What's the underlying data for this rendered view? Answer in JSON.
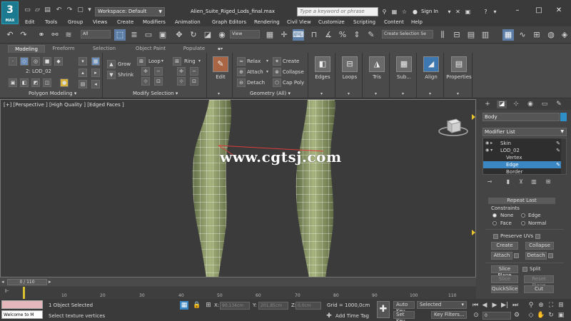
{
  "app": {
    "logo_text": "3",
    "logo_sub": "MAX",
    "title": "Alien_Suite_Riged_Lods_final.max",
    "workspace": "Workspace: Default",
    "search_placeholder": "Type a keyword or phrase",
    "signin": "Sign In"
  },
  "menu": [
    "Edit",
    "Tools",
    "Group",
    "Views",
    "Create",
    "Modifiers",
    "Animation",
    "Graph Editors",
    "Rendering",
    "Civil View",
    "Customize",
    "Scripting",
    "Content",
    "Help"
  ],
  "toolbar": {
    "selection_filter": "All",
    "ref_coord": "View",
    "named_selection": "Create Selection Se"
  },
  "ribbon": {
    "tabs": [
      "Modeling",
      "Freeform",
      "Selection",
      "Object Paint",
      "Populate"
    ],
    "lod_label": "2: LOD_02",
    "polygon_modeling": "Polygon Modeling",
    "modify_selection": "Modify Selection",
    "grow": "Grow",
    "shrink": "Shrink",
    "loop": "Loop",
    "ring": "Ring",
    "edit": "Edit",
    "relax": "Relax",
    "attach": "Attach",
    "detach": "Detach",
    "create": "Create",
    "collapse": "Collapse",
    "cap_poly": "Cap Poly",
    "geometry_all": "Geometry (All)",
    "big_buttons": [
      "Edges",
      "Loops",
      "Tris",
      "Sub...",
      "Align",
      "Properties"
    ]
  },
  "viewport": {
    "label": "[+] [Perspective ] [High Quality ] [Edged Faces ]",
    "watermark": "www.cgtsj.com"
  },
  "command_panel": {
    "object_name": "Body",
    "modifier_list": "Modifier List",
    "stack": [
      "Skin",
      "LOD_02",
      "Vertex",
      "Edge",
      "Border"
    ],
    "repeat_last": "Repeat Last",
    "constraints": "Constraints",
    "none": "None",
    "edge": "Edge",
    "face": "Face",
    "normal": "Normal",
    "preserve_uvs": "Preserve UVs",
    "create": "Create",
    "collapse": "Collapse",
    "attach": "Attach",
    "detach": "Detach",
    "slice_plane": "Slice Plane",
    "split": "Split",
    "slice": "Slice",
    "reset_plane": "Reset Plane",
    "quickslice": "QuickSlice",
    "cut": "Cut"
  },
  "timeline": {
    "frame": "0 / 110",
    "ticks": [
      "10",
      "20",
      "30",
      "40",
      "50",
      "60",
      "70",
      "80",
      "90",
      "100",
      "110"
    ]
  },
  "status": {
    "welcome": "Welcome to M",
    "selected": "1 Object Selected",
    "prompt": "Select texture vertices",
    "x_label": "X:",
    "x_val": "90,134cm",
    "y_label": "Y:",
    "y_val": "201,85cm",
    "z_label": "Z:",
    "z_val": "0,0cm",
    "grid": "Grid = 1000,0cm",
    "add_time_tag": "Add Time Tag",
    "auto_key": "Auto Key",
    "set_key": "Set Key",
    "selected_dd": "Selected",
    "key_filters": "Key Filters...",
    "frame_field": "0"
  }
}
